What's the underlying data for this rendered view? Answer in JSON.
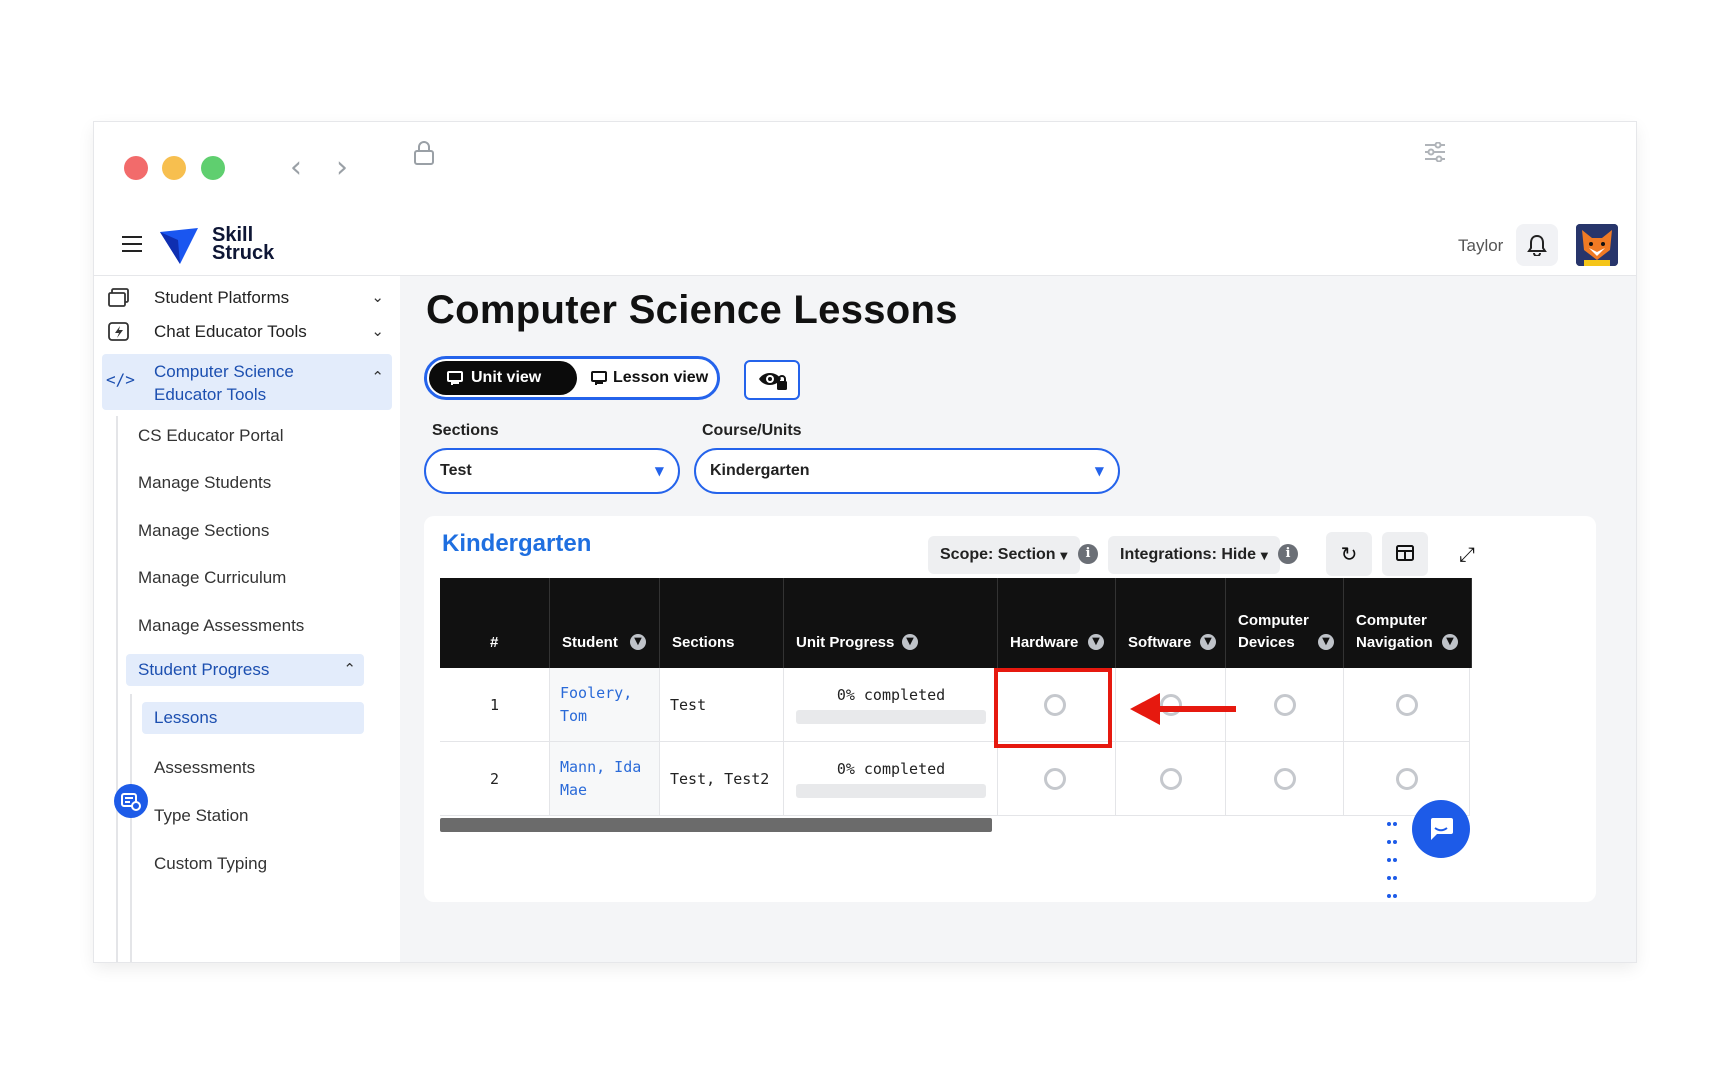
{
  "brand": {
    "name_line1": "Skill",
    "name_line2": "Struck"
  },
  "header": {
    "username": "Taylor"
  },
  "sidebar": {
    "items": [
      {
        "label": "Student Platforms"
      },
      {
        "label": "Chat Educator Tools"
      },
      {
        "label_line1": "Computer Science",
        "label_line2": "Educator Tools"
      }
    ],
    "sub_items": [
      {
        "label": "CS Educator Portal"
      },
      {
        "label": "Manage Students"
      },
      {
        "label": "Manage Sections"
      },
      {
        "label": "Manage Curriculum"
      },
      {
        "label": "Manage Assessments"
      },
      {
        "label": "Student Progress"
      },
      {
        "label": "Lessons"
      },
      {
        "label": "Assessments"
      },
      {
        "label": "Type Station"
      },
      {
        "label": "Custom Typing"
      }
    ]
  },
  "page": {
    "title": "Computer Science Lessons",
    "view_toggle": {
      "unit": "Unit view",
      "lesson": "Lesson view"
    },
    "filters": {
      "sections_label": "Sections",
      "sections_value": "Test",
      "course_label": "Course/Units",
      "course_value": "Kindergarten"
    }
  },
  "card": {
    "title": "Kindergarten",
    "scope_btn": "Scope: Section",
    "integrations_btn": "Integrations: Hide",
    "columns": [
      {
        "label": "#"
      },
      {
        "label": "Student"
      },
      {
        "label": "Sections"
      },
      {
        "label": "Unit Progress"
      },
      {
        "label": "Hardware"
      },
      {
        "label": "Software"
      },
      {
        "label_line1": "Computer",
        "label_line2": "Devices"
      },
      {
        "label_line1": "Computer",
        "label_line2": "Navigation"
      }
    ],
    "rows": [
      {
        "num": "1",
        "student_line1": "Foolery,",
        "student_line2": "Tom",
        "sections": "Test",
        "progress": "0% completed",
        "progress_value": 0
      },
      {
        "num": "2",
        "student_line1": "Mann, Ida",
        "student_line2": "Mae",
        "sections": "Test, Test2",
        "progress": "0% completed",
        "progress_value": 0
      }
    ]
  },
  "colors": {
    "accent": "#2463eb",
    "annotation": "#e6190f",
    "link": "#2a6ad8"
  }
}
